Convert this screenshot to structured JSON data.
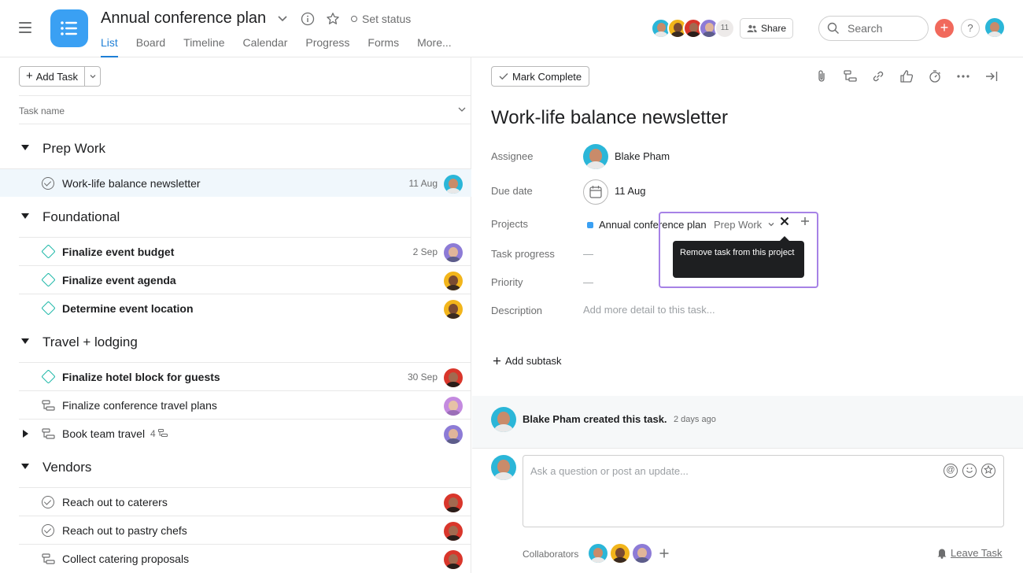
{
  "header": {
    "project_title": "Annual conference plan",
    "set_status": "Set status",
    "tabs": [
      "List",
      "Board",
      "Timeline",
      "Calendar",
      "Progress",
      "Forms",
      "More..."
    ],
    "active_tab": "List",
    "member_overflow_count": "11",
    "share_label": "Share",
    "search_placeholder": "Search",
    "accent_color": "#1e7fd6"
  },
  "list": {
    "add_task_label": "Add Task",
    "column_header": "Task name",
    "sections": [
      {
        "title": "Prep Work",
        "tasks": [
          {
            "name": "Work-life balance newsletter",
            "date": "11 Aug",
            "bold": false,
            "icon": "check-circle-icon",
            "selected": true
          }
        ]
      },
      {
        "title": "Foundational",
        "tasks": [
          {
            "name": "Finalize event budget",
            "date": "2 Sep",
            "bold": true,
            "icon": "milestone-diamond-icon"
          },
          {
            "name": "Finalize event agenda",
            "date": "",
            "bold": true,
            "icon": "milestone-diamond-icon"
          },
          {
            "name": "Determine event location",
            "date": "",
            "bold": true,
            "icon": "milestone-diamond-icon"
          }
        ]
      },
      {
        "title": "Travel + lodging",
        "tasks": [
          {
            "name": "Finalize hotel block for guests",
            "date": "30 Sep",
            "bold": true,
            "icon": "milestone-diamond-icon"
          },
          {
            "name": "Finalize conference travel plans",
            "date": "",
            "bold": false,
            "icon": "subtasks-icon"
          },
          {
            "name": "Book team travel",
            "date": "",
            "bold": false,
            "icon": "subtasks-icon",
            "subtask_count": "4"
          }
        ]
      },
      {
        "title": "Vendors",
        "tasks": [
          {
            "name": "Reach out to caterers",
            "date": "",
            "bold": false,
            "icon": "check-circle-icon"
          },
          {
            "name": "Reach out to pastry chefs",
            "date": "",
            "bold": false,
            "icon": "check-circle-icon"
          },
          {
            "name": "Collect catering proposals",
            "date": "",
            "bold": false,
            "icon": "subtasks-icon"
          }
        ]
      }
    ]
  },
  "detail": {
    "mark_complete_label": "Mark Complete",
    "title": "Work-life balance newsletter",
    "fields": {
      "assignee_label": "Assignee",
      "assignee_value": "Blake Pham",
      "due_label": "Due date",
      "due_value": "11 Aug",
      "projects_label": "Projects",
      "project_name": "Annual conference plan",
      "project_section": "Prep Work",
      "progress_label": "Task progress",
      "progress_value": "—",
      "priority_label": "Priority",
      "priority_value": "—",
      "description_label": "Description",
      "description_placeholder": "Add more detail to this task..."
    },
    "tooltip": "Remove task from this project",
    "add_subtask_label": "Add subtask",
    "story": {
      "who": "Blake Pham created this task.",
      "when": "2 days ago"
    },
    "comment_placeholder": "Ask a question or post an update...",
    "collaborators_label": "Collaborators",
    "leave_task_label": "Leave Task"
  }
}
